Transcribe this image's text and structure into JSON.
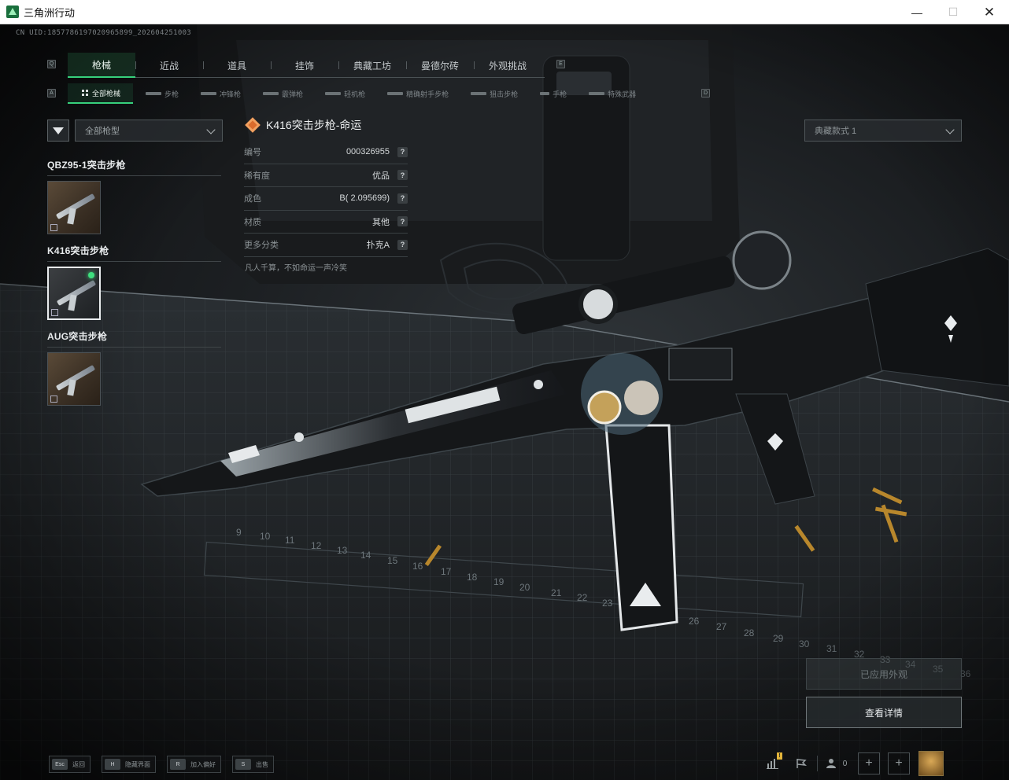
{
  "window": {
    "title": "三角洲行动"
  },
  "uid_text": "CN UID:1857786197020965899_202604251003",
  "tabs": [
    {
      "label": "枪械",
      "active": true
    },
    {
      "label": "近战"
    },
    {
      "label": "道具"
    },
    {
      "label": "挂饰"
    },
    {
      "label": "典藏工坊"
    },
    {
      "label": "曼德尔砖"
    },
    {
      "label": "外观挑战"
    }
  ],
  "tab_keys": {
    "prev": "Q",
    "next": "E",
    "sub_prev": "A",
    "sub_next": "D"
  },
  "subtabs": [
    {
      "label": "全部枪械",
      "active": true
    },
    {
      "label": "步枪"
    },
    {
      "label": "冲锋枪"
    },
    {
      "label": "霰弹枪"
    },
    {
      "label": "轻机枪"
    },
    {
      "label": "精确射手步枪"
    },
    {
      "label": "狙击步枪"
    },
    {
      "label": "手枪"
    },
    {
      "label": "特殊武器"
    }
  ],
  "filter": {
    "value": "全部枪型"
  },
  "style_select": {
    "value": "典藏款式 1"
  },
  "gun_list": [
    {
      "name": "QBZ95-1突击步枪",
      "selected": false
    },
    {
      "name": "K416突击步枪",
      "selected": true
    },
    {
      "name": "AUG突击步枪",
      "selected": false
    }
  ],
  "detail": {
    "title": "K416突击步枪-命运",
    "rows": [
      {
        "key": "编号",
        "value": "000326955"
      },
      {
        "key": "稀有度",
        "value": "优品"
      },
      {
        "key": "成色",
        "value": "B( 2.095699)"
      },
      {
        "key": "材质",
        "value": "其他"
      },
      {
        "key": "更多分类",
        "value": "扑克A"
      }
    ],
    "quote": "凡人千算，不如命运一声冷笑"
  },
  "buttons": {
    "applied": "已应用外观",
    "details": "查看详情"
  },
  "hotkeys": [
    {
      "key": "Esc",
      "label": "返回"
    },
    {
      "key": "H",
      "label": "隐藏界面"
    },
    {
      "key": "R",
      "label": "加入偏好"
    },
    {
      "key": "S",
      "label": "出售"
    }
  ],
  "tray": {
    "friends_count": "0",
    "notif": "!"
  },
  "colors": {
    "accent": "#37d07c",
    "rarity": "#d96b2c"
  }
}
